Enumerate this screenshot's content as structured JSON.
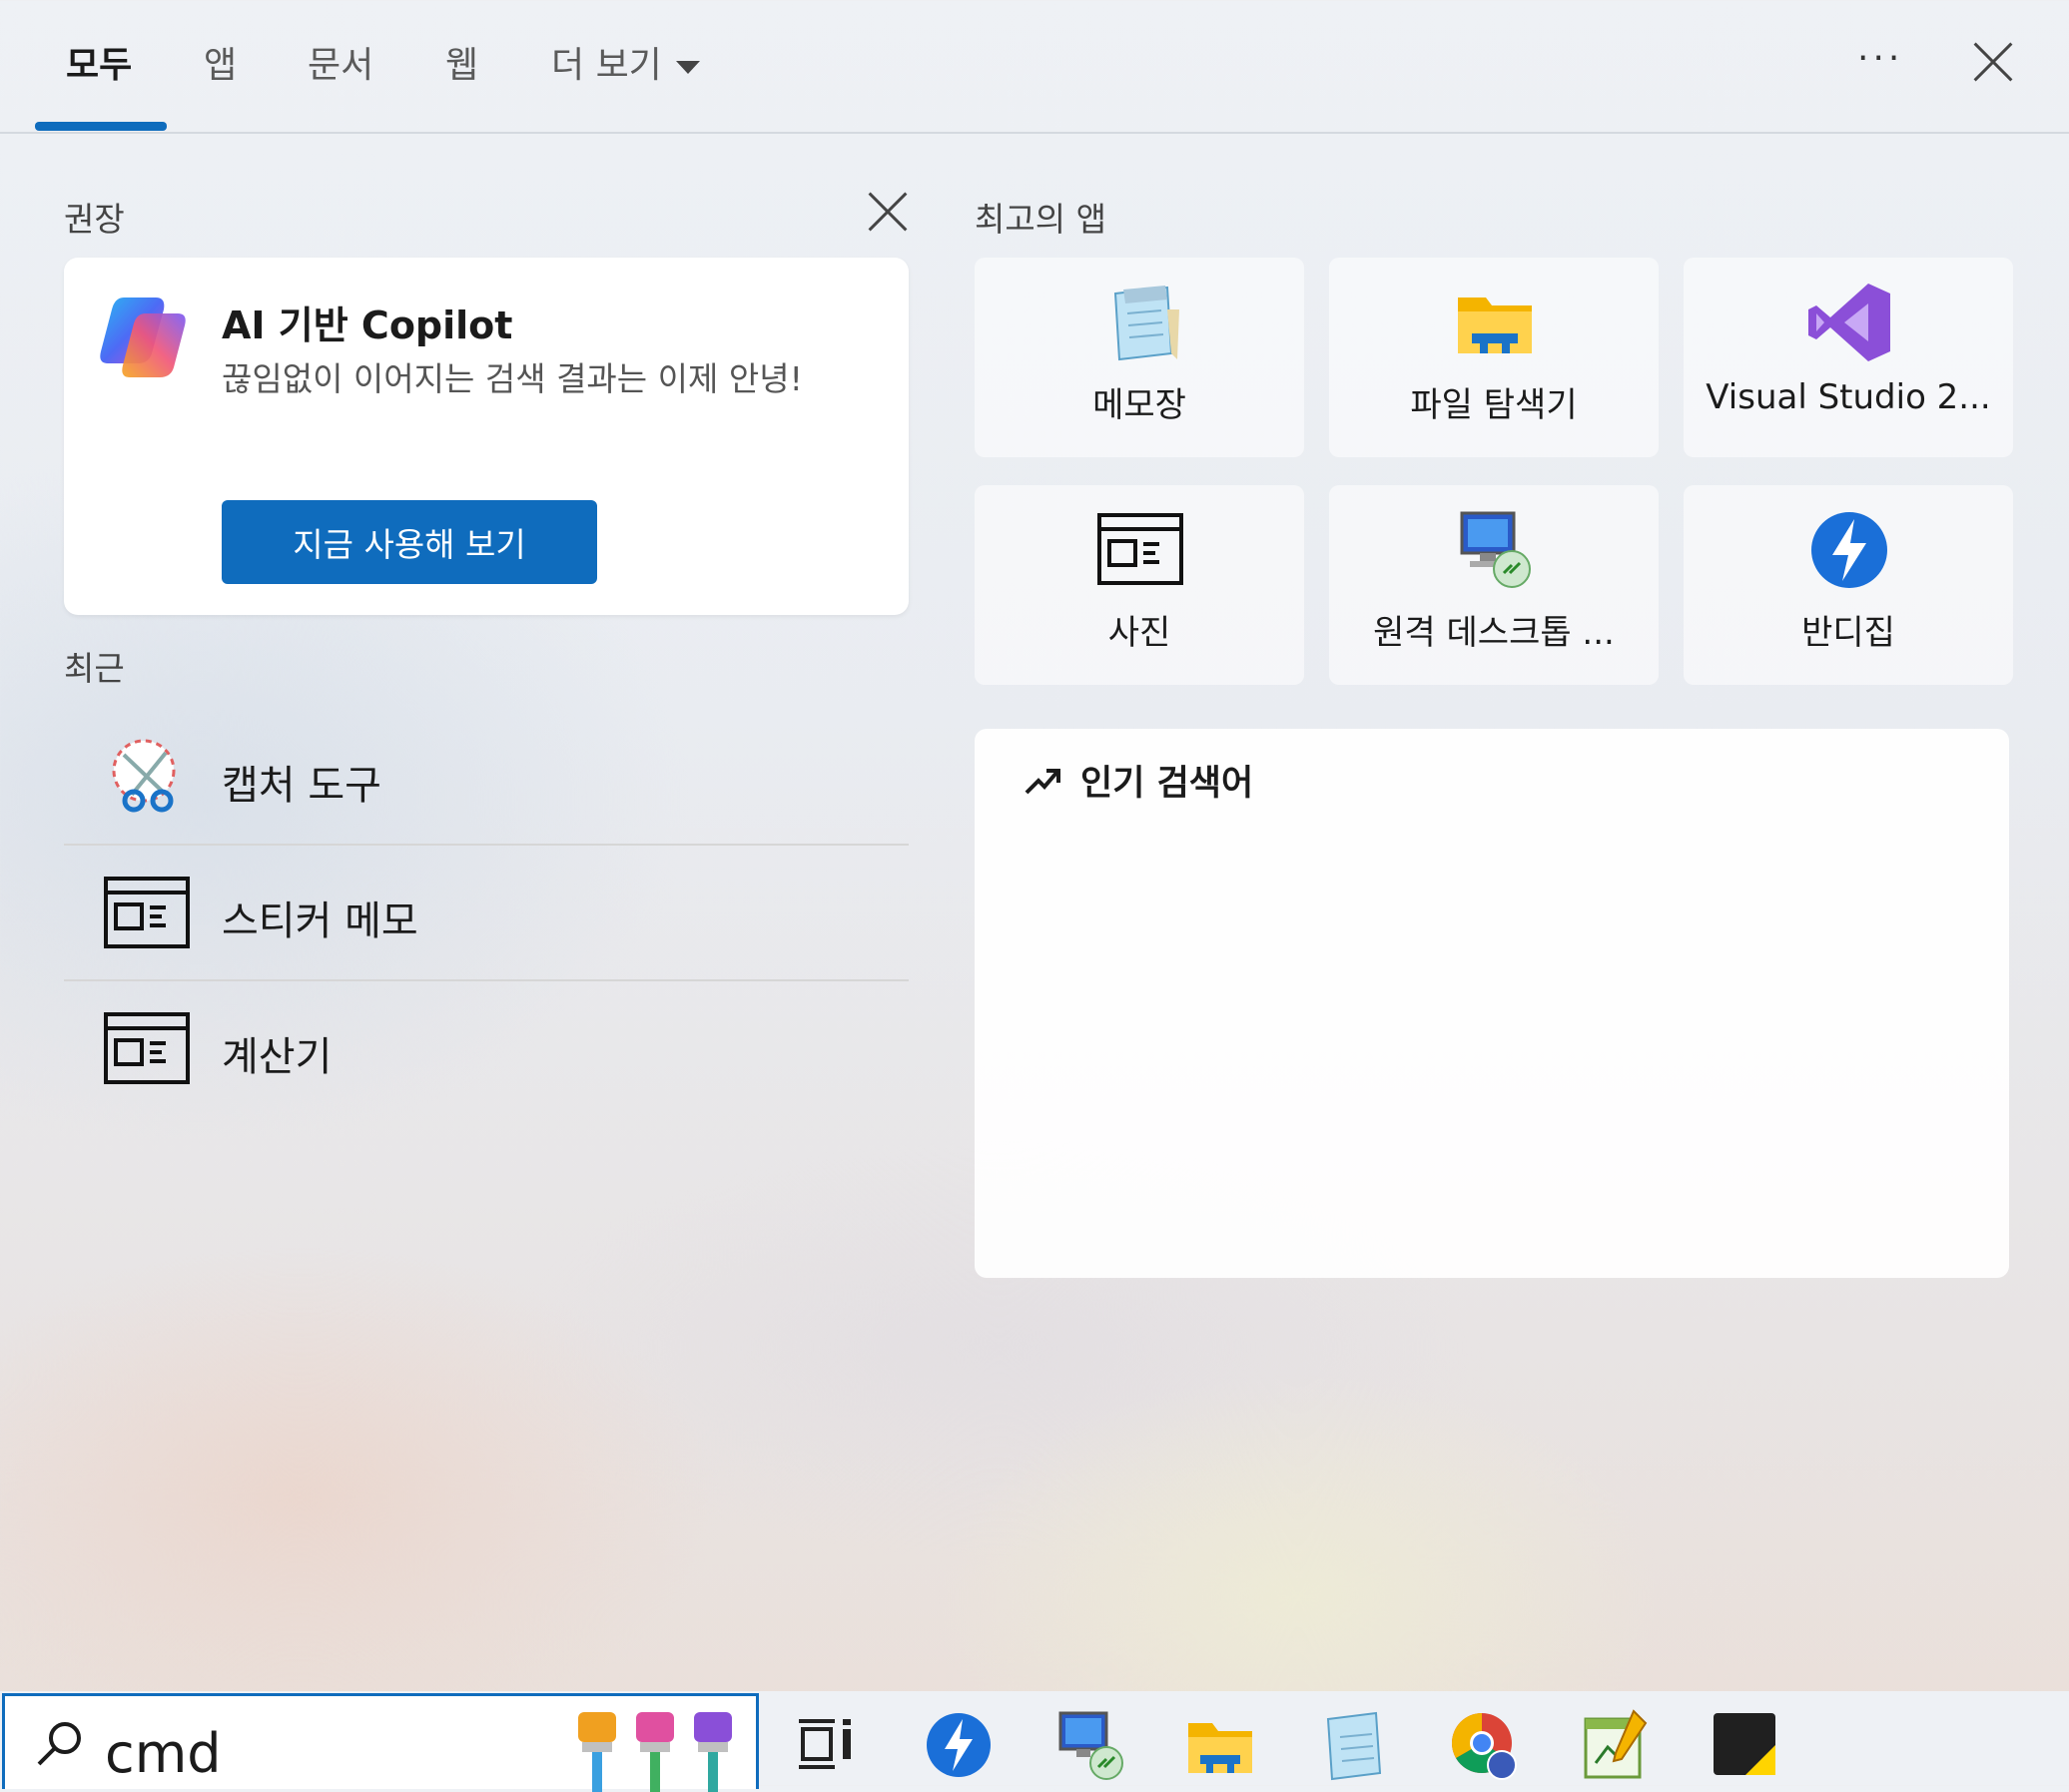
{
  "tabs": [
    {
      "label": "모두",
      "active": true
    },
    {
      "label": "앱"
    },
    {
      "label": "문서"
    },
    {
      "label": "웹"
    },
    {
      "label": "더 보기"
    }
  ],
  "recommended": {
    "title": "권장",
    "card": {
      "title": "AI 기반 Copilot",
      "description": "끊임없이 이어지는 검색 결과는 이제 안녕!",
      "button_label": "지금 사용해 보기"
    }
  },
  "recent": {
    "title": "최근",
    "items": [
      {
        "label": "캡처 도구",
        "icon": "snipping-tool-icon"
      },
      {
        "label": "스티커 메모",
        "icon": "app-window-icon"
      },
      {
        "label": "계산기",
        "icon": "app-window-icon"
      }
    ]
  },
  "top_apps": {
    "title": "최고의 앱",
    "items": [
      {
        "label": "메모장",
        "icon": "notepad-icon"
      },
      {
        "label": "파일 탐색기",
        "icon": "file-explorer-icon"
      },
      {
        "label": "Visual Studio 2...",
        "icon": "visual-studio-icon"
      },
      {
        "label": "사진",
        "icon": "app-window-icon"
      },
      {
        "label": "원격 데스크톱 ...",
        "icon": "remote-desktop-icon"
      },
      {
        "label": "반디집",
        "icon": "bandizip-icon"
      }
    ]
  },
  "trending": {
    "title": "인기 검색어"
  },
  "search": {
    "value": "cmd"
  },
  "taskbar": {
    "items": [
      "task-view-icon",
      "bandizip-icon",
      "remote-desktop-icon",
      "file-explorer-icon",
      "notepad-icon",
      "chrome-icon",
      "diagram-editor-icon",
      "sticky-notes-icon"
    ]
  },
  "colors": {
    "accent": "#0f6cbd"
  }
}
